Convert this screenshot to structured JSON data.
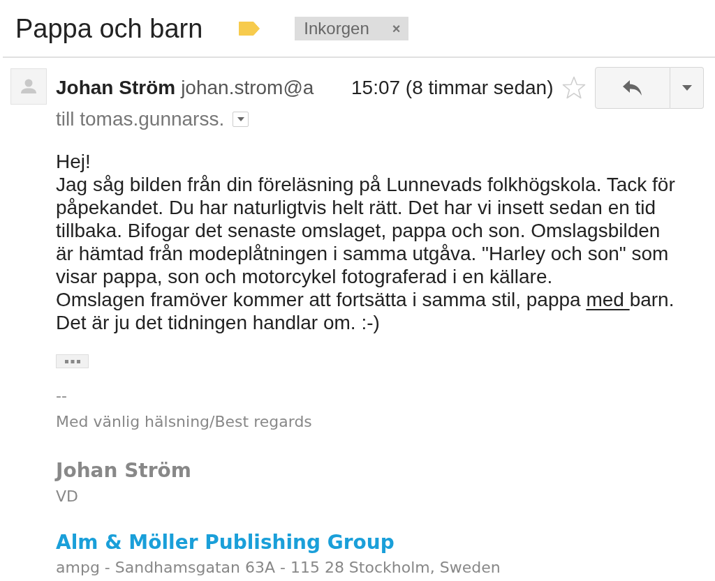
{
  "thread": {
    "subject": "Pappa och barn",
    "important": true,
    "chip": {
      "label": "Inkorgen",
      "close": "×"
    }
  },
  "message": {
    "sender_name": "Johan Ström",
    "sender_email": "johan.strom@a",
    "time": "15:07 (8 timmar sedan)",
    "starred": false,
    "recipients": "till tomas.gunnarss.",
    "body": [
      {
        "segments": [
          {
            "text": "Hej!",
            "underlined": false
          }
        ]
      },
      {
        "segments": [
          {
            "text": "Jag såg bilden från din föreläsning på Lunnevads folkhögskola. Tack för",
            "underlined": false
          }
        ]
      },
      {
        "segments": [
          {
            "text": "påpekandet. Du har naturligtvis helt rätt. Det har vi insett sedan en tid",
            "underlined": false
          }
        ]
      },
      {
        "segments": [
          {
            "text": "tillbaka. Bifogar det senaste omslaget, pappa och son. Omslagsbilden",
            "underlined": false
          }
        ]
      },
      {
        "segments": [
          {
            "text": "är hämtad från modeplåtningen i samma utgåva. \"Harley och son\" som",
            "underlined": false
          }
        ]
      },
      {
        "segments": [
          {
            "text": "visar pappa, son och motorcykel fotograferad i en källare.",
            "underlined": false
          }
        ]
      },
      {
        "segments": [
          {
            "text": "Omslagen framöver kommer att fortsätta i samma stil, pappa ",
            "underlined": false
          },
          {
            "text": "med ",
            "underlined": true
          },
          {
            "text": "barn.",
            "underlined": false
          }
        ]
      },
      {
        "segments": [
          {
            "text": "Det är ju det tidningen handlar om. :-)",
            "underlined": false
          }
        ]
      }
    ],
    "signature": {
      "separator": "--",
      "closing": "Med vänlig hälsning/Best regards",
      "name": "Johan Ström",
      "role": "VD",
      "company": "Alm & Möller Publishing Group",
      "address": "ampg - Sandhamsgatan 63A - 115 28 Stockholm, Sweden"
    }
  }
}
